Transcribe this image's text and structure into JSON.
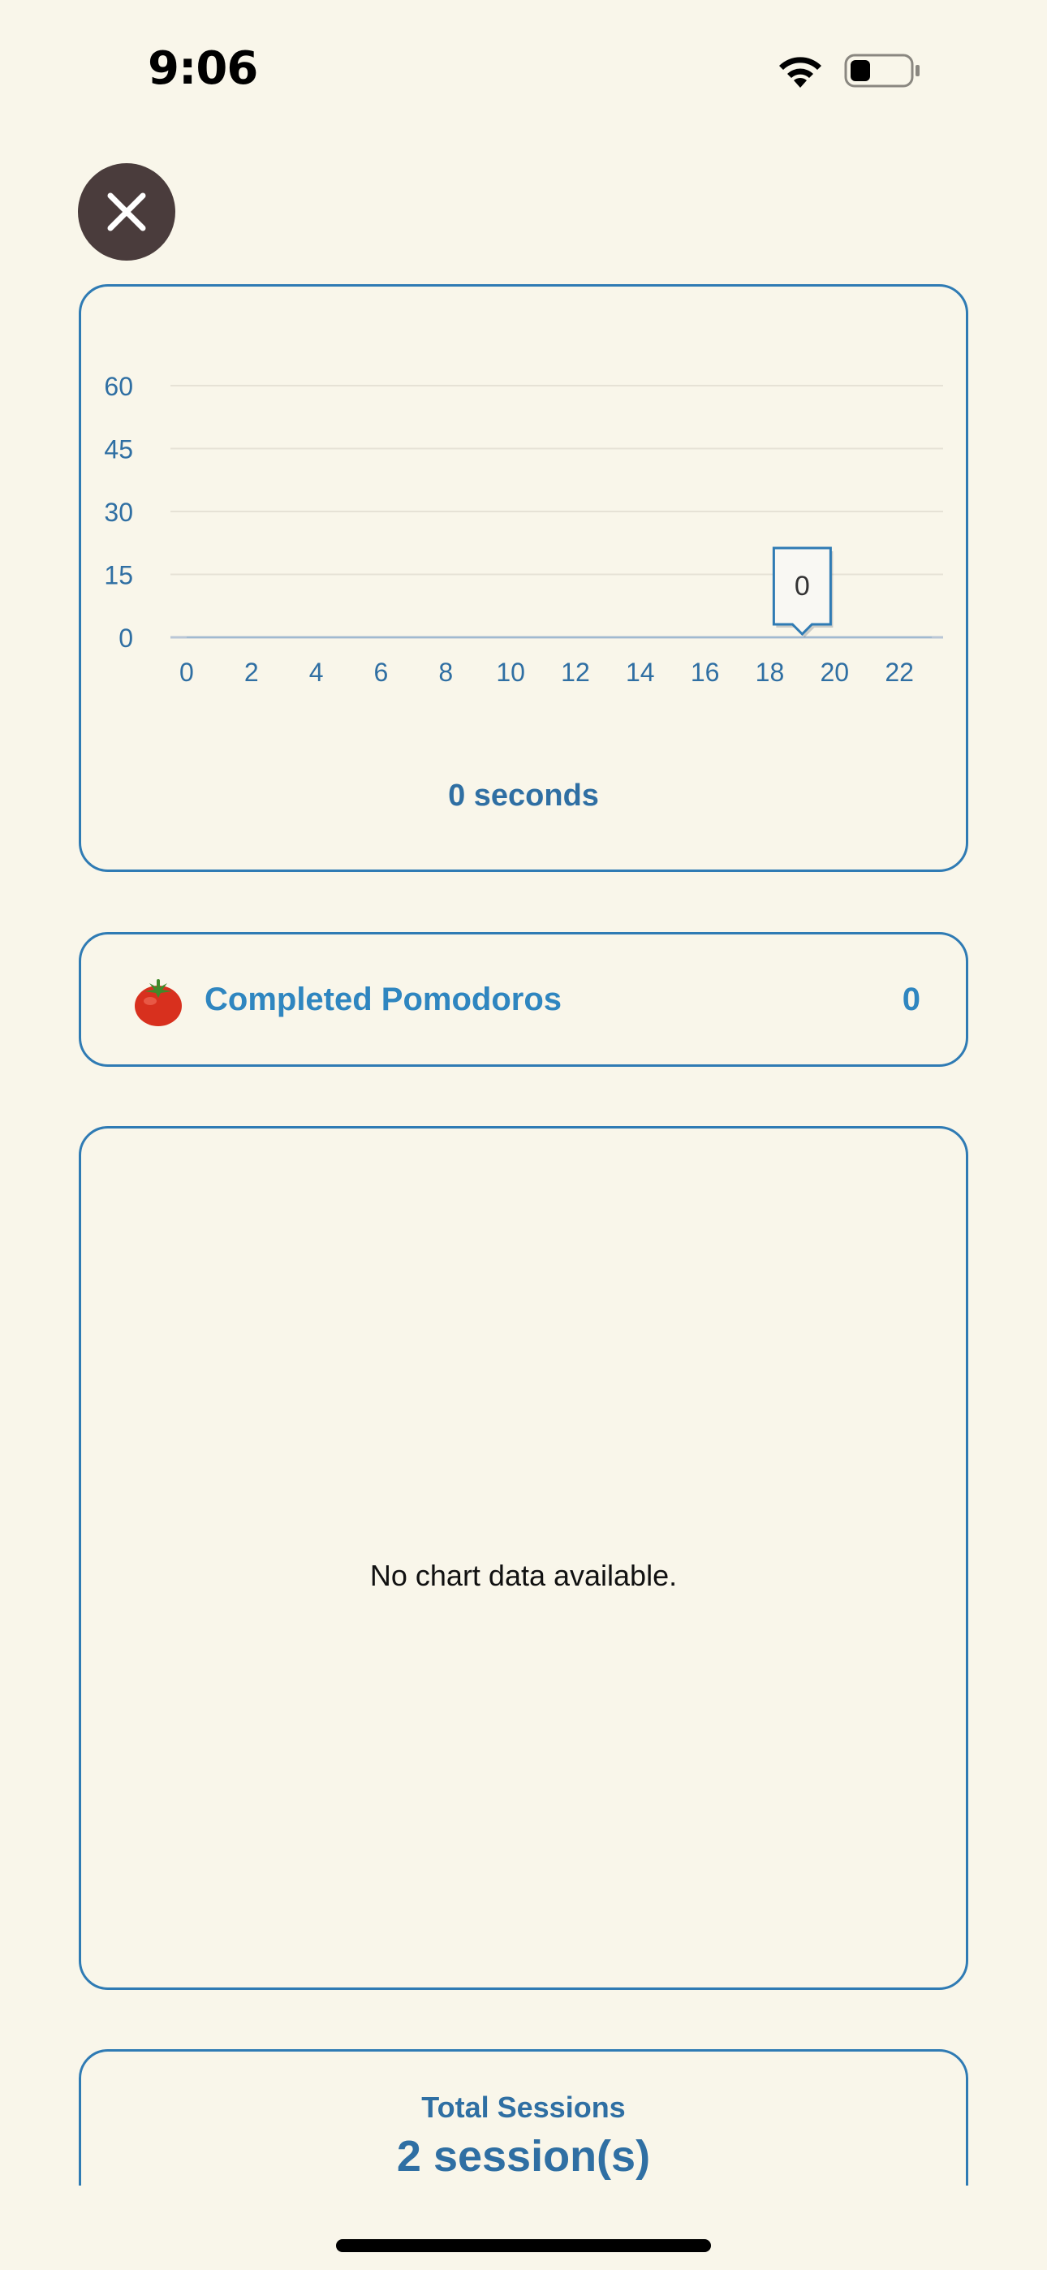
{
  "status_bar": {
    "time": "9:06",
    "icons": [
      "wifi-icon",
      "battery-icon"
    ]
  },
  "close_button": {
    "icon": "close-icon"
  },
  "chart_data": {
    "type": "line",
    "x": [
      0,
      2,
      4,
      6,
      8,
      10,
      12,
      14,
      16,
      18,
      20,
      22
    ],
    "x_ticks": [
      "0",
      "2",
      "4",
      "6",
      "8",
      "10",
      "12",
      "14",
      "16",
      "18",
      "20",
      "22"
    ],
    "y_ticks": [
      "0",
      "15",
      "30",
      "45",
      "60"
    ],
    "ylim": [
      0,
      60
    ],
    "xlim": [
      -0.5,
      23.5
    ],
    "values": [
      0,
      0,
      0,
      0,
      0,
      0,
      0,
      0,
      0,
      0,
      0,
      0,
      0,
      0,
      0,
      0,
      0,
      0,
      0,
      0,
      0,
      0,
      0,
      0
    ],
    "tooltip": {
      "x": 19,
      "value": "0"
    },
    "grid": true,
    "title": "",
    "xlabel": "",
    "ylabel": ""
  },
  "duration_text": "0 seconds",
  "pomodoro": {
    "icon": "tomato-icon",
    "label": "Completed Pomodoros",
    "count": "0"
  },
  "empty_chart": {
    "message": "No chart data available."
  },
  "sessions": {
    "title": "Total Sessions",
    "value": "2 session(s)"
  },
  "colors": {
    "background": "#f9f6ea",
    "accent": "#2f7bb4",
    "close_button": "#4a3c3c"
  }
}
